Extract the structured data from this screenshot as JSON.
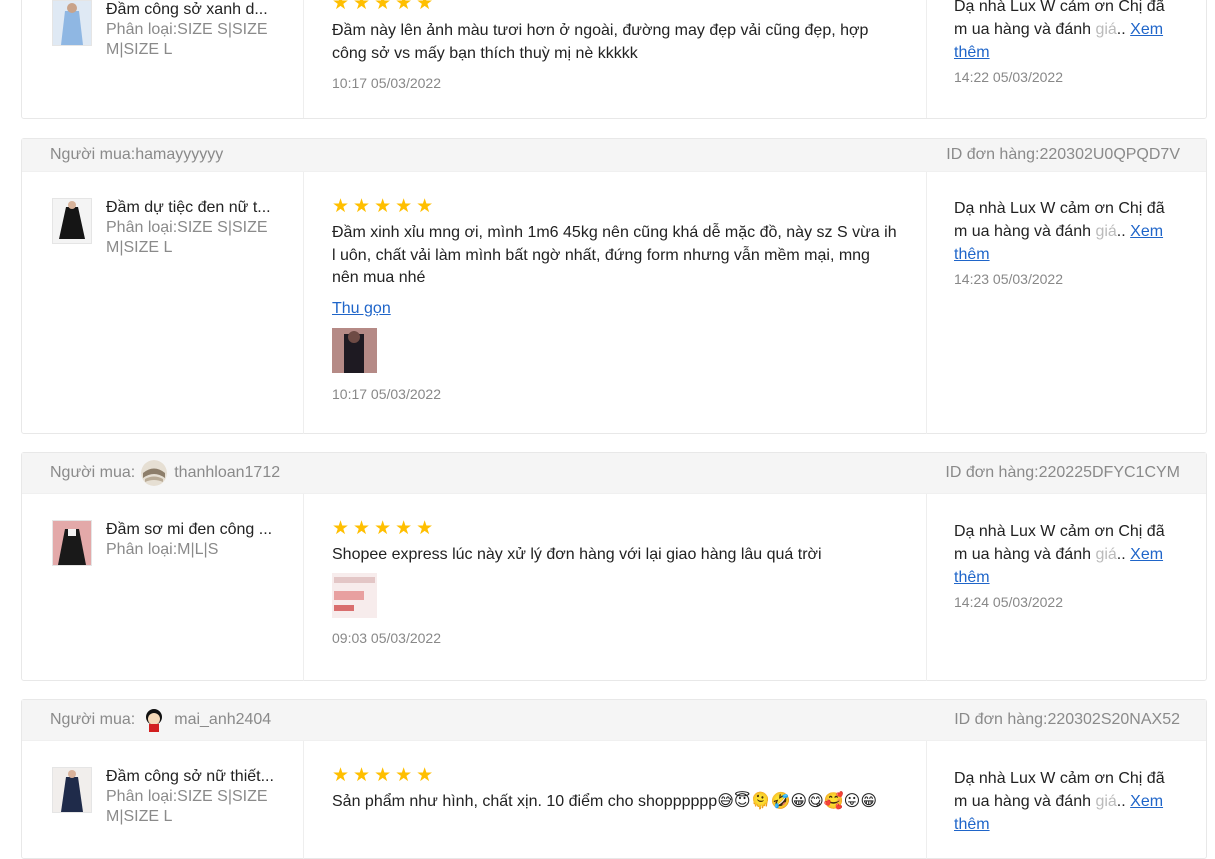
{
  "reviews": [
    {
      "buyer_prefix": "",
      "buyer": "",
      "order_id": "",
      "product_name": "Đầm công sở xanh d...",
      "variation": "Phân loại:SIZE S|SIZE M|SIZE L",
      "rating": 5,
      "review": "Đầm này lên ảnh màu tươi hơn ở ngoài, đường may đẹp vải cũng đẹp, hợp công sở vs mấy bạn thích thuỳ mị nè kkkkk",
      "time": "10:17 05/03/2022",
      "reply_main": "Dạ nhà Lux W cảm ơn Chị đã m ua hàng và đánh ",
      "reply_fade": "giá",
      "reply_ellipsis": "..",
      "reply_more": "Xem thêm",
      "reply_time": "14:22 05/03/2022"
    },
    {
      "buyer_prefix": "Người mua:",
      "buyer": "hamayyyyyy",
      "order_id": "ID đơn hàng:220302U0QPQD7V",
      "product_name": "Đầm dự tiệc đen nữ t...",
      "variation": "Phân loại:SIZE S|SIZE M|SIZE L",
      "rating": 5,
      "review": "Đầm xinh xỉu mng ơi, mình 1m6 45kg nên cũng khá dễ mặc đồ, này sz S vừa ih l uôn, chất vải làm mình bất ngờ nhất, đứng form nhưng vẫn mềm mại, mng nên mua nhé",
      "collapse": "Thu gọn",
      "time": "10:17 05/03/2022",
      "reply_main": "Dạ nhà Lux W cảm ơn Chị đã m ua hàng và đánh ",
      "reply_fade": "giá",
      "reply_ellipsis": "..",
      "reply_more": "Xem thêm",
      "reply_time": "14:23 05/03/2022"
    },
    {
      "buyer_prefix": "Người mua:",
      "buyer": "thanhloan1712",
      "order_id": "ID đơn hàng:220225DFYC1CYM",
      "product_name": "Đầm sơ mi đen công ...",
      "variation": "Phân loại:M|L|S",
      "rating": 5,
      "review": "Shopee express lúc này xử lý đơn hàng với lại giao hàng lâu quá trời",
      "time": "09:03 05/03/2022",
      "reply_main": "Dạ nhà Lux W cảm ơn Chị đã m ua hàng và đánh ",
      "reply_fade": "giá",
      "reply_ellipsis": "..",
      "reply_more": "Xem thêm",
      "reply_time": "14:24 05/03/2022"
    },
    {
      "buyer_prefix": "Người mua:",
      "buyer": "mai_anh2404",
      "order_id": "ID đơn hàng:220302S20NAX52",
      "product_name": "Đầm công sở nữ thiết...",
      "variation": "Phân loại:SIZE S|SIZE M|SIZE L",
      "rating": 5,
      "review": "Sản phẩm như hình, chất xịn. 10 điểm cho shopppppp😅😇🫠🤣😀😋🥰😛😁",
      "reply_main": "Dạ nhà Lux W cảm ơn Chị đã m ua hàng và đánh ",
      "reply_fade": "giá",
      "reply_ellipsis": "..",
      "reply_more": "Xem thêm"
    }
  ],
  "star_glyph": "★★★★★",
  "colors": {
    "star": "#ffbf00",
    "link": "#1f65c9",
    "muted": "#8a8a8a"
  }
}
